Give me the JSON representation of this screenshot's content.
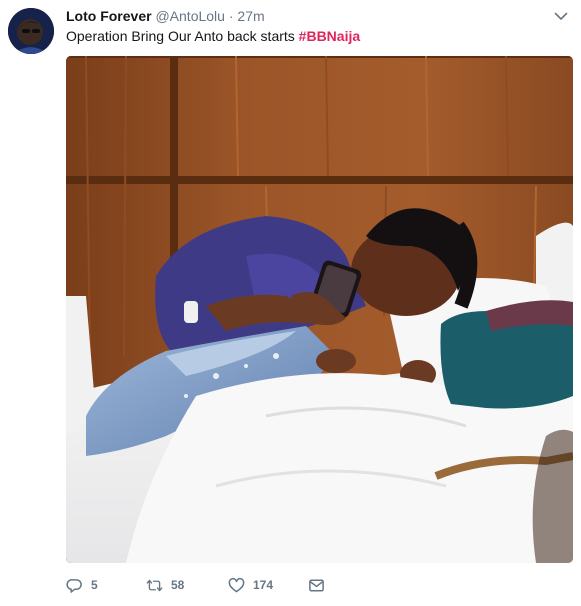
{
  "tweet": {
    "display_name": "Loto Forever",
    "handle": "@AntoLolu",
    "separator": "·",
    "time": "27m",
    "text": "Operation Bring Our Anto back starts ",
    "hashtag": "#BBNaija",
    "avatar_icon": "avatar-image",
    "menu_icon": "chevron-down-icon",
    "media_description_icon": "photo"
  },
  "actions": {
    "reply": {
      "icon": "reply-icon",
      "count": "5"
    },
    "retweet": {
      "icon": "retweet-icon",
      "count": "58"
    },
    "like": {
      "icon": "heart-icon",
      "count": "174"
    },
    "dm": {
      "icon": "envelope-icon"
    }
  },
  "colors": {
    "text": "#14171a",
    "secondary": "#657786",
    "hashtag": "#e0245e"
  }
}
